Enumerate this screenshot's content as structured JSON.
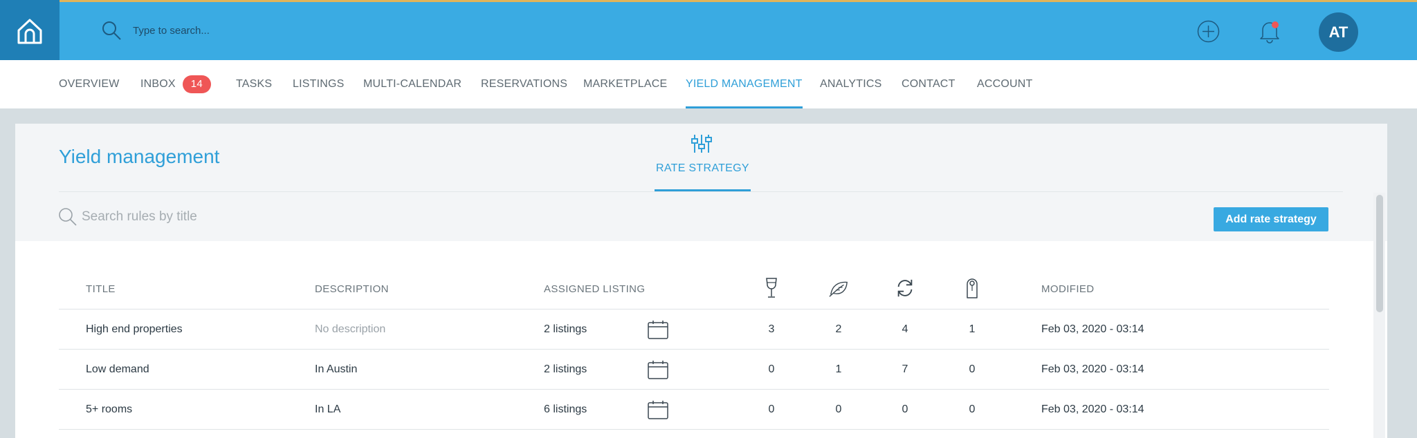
{
  "topbar": {
    "search_placeholder": "Type to search...",
    "avatar_initials": "AT",
    "colors": {
      "bar": "#3aabe3",
      "home": "#1f7fb6",
      "accent_line": "#e1b45a"
    }
  },
  "nav": {
    "items": [
      {
        "label": "OVERVIEW"
      },
      {
        "label": "INBOX",
        "badge": "14"
      },
      {
        "label": "TASKS"
      },
      {
        "label": "LISTINGS"
      },
      {
        "label": "MULTI-CALENDAR"
      },
      {
        "label": "RESERVATIONS"
      },
      {
        "label": "MARKETPLACE"
      },
      {
        "label": "YIELD MANAGEMENT",
        "active": true
      },
      {
        "label": "ANALYTICS"
      },
      {
        "label": "CONTACT"
      },
      {
        "label": "ACCOUNT"
      }
    ]
  },
  "page": {
    "title": "Yield management",
    "tab_label": "RATE STRATEGY",
    "search_placeholder": "Search rules by title",
    "add_button": "Add rate strategy"
  },
  "table": {
    "columns": {
      "title": "TITLE",
      "description": "DESCRIPTION",
      "assigned": "ASSIGNED LISTING",
      "icon_cols": [
        "wine-glass-icon",
        "leaf-icon",
        "refresh-icon",
        "door-hanger-icon"
      ],
      "modified": "MODIFIED"
    },
    "rows": [
      {
        "title": "High end properties",
        "description": "No description",
        "description_muted": true,
        "listings": "2 listings",
        "c1": "3",
        "c2": "2",
        "c3": "4",
        "c4": "1",
        "modified": "Feb 03, 2020 - 03:14"
      },
      {
        "title": "Low demand",
        "description": "In Austin",
        "description_muted": false,
        "listings": "2 listings",
        "c1": "0",
        "c2": "1",
        "c3": "7",
        "c4": "0",
        "modified": "Feb 03, 2020 - 03:14"
      },
      {
        "title": "5+ rooms",
        "description": "In LA",
        "description_muted": false,
        "listings": "6 listings",
        "c1": "0",
        "c2": "0",
        "c3": "0",
        "c4": "0",
        "modified": "Feb 03, 2020 - 03:14"
      }
    ]
  }
}
